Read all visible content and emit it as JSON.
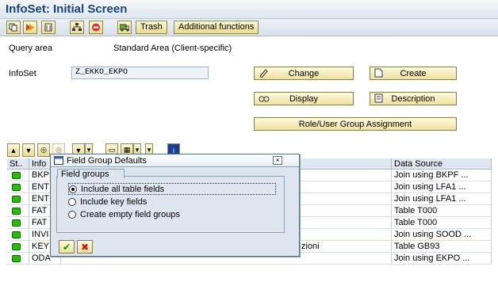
{
  "title": "InfoSet: Initial Screen",
  "toolbar": {
    "trash_label": "Trash",
    "additional_label": "Additional functions"
  },
  "form": {
    "query_area_label": "Query area",
    "query_area_value": "Standard Area (Client-specific)",
    "infoset_label": "InfoSet",
    "infoset_value": "Z_EKKO_EKPO"
  },
  "buttons": {
    "change": "Change",
    "create": "Create",
    "display": "Display",
    "description": "Description",
    "role_assign": "Role/User Group Assignment"
  },
  "table": {
    "columns": [
      "St..",
      "Info",
      "Data Source"
    ],
    "rows": [
      {
        "name": "BKPF",
        "desc": "",
        "source": "Join using BKPF ..."
      },
      {
        "name": "ENT",
        "desc": "",
        "source": "Join using LFA1 ..."
      },
      {
        "name": "ENT",
        "desc": "",
        "source": "Join using LFA1 ..."
      },
      {
        "name": "FAT",
        "desc": "",
        "source": "Table T000"
      },
      {
        "name": "FAT",
        "desc": "",
        "source": "Table T000"
      },
      {
        "name": "INVI",
        "desc": "",
        "source": "Join using SOOD ..."
      },
      {
        "name": "KEY",
        "desc": "zioni",
        "source": "Table GB93"
      },
      {
        "name": "ODA",
        "desc": "",
        "source": "Join using EKPO ..."
      }
    ]
  },
  "dialog": {
    "title": "Field Group Defaults",
    "group_label": "Field groups",
    "options": [
      {
        "label": "Include all table fields",
        "selected": true
      },
      {
        "label": "Include key fields",
        "selected": false
      },
      {
        "label": "Create empty field groups",
        "selected": false
      }
    ]
  },
  "colors": {
    "title": "#16437c",
    "status_green": "#27c000",
    "button_face": "#eee1a2"
  }
}
